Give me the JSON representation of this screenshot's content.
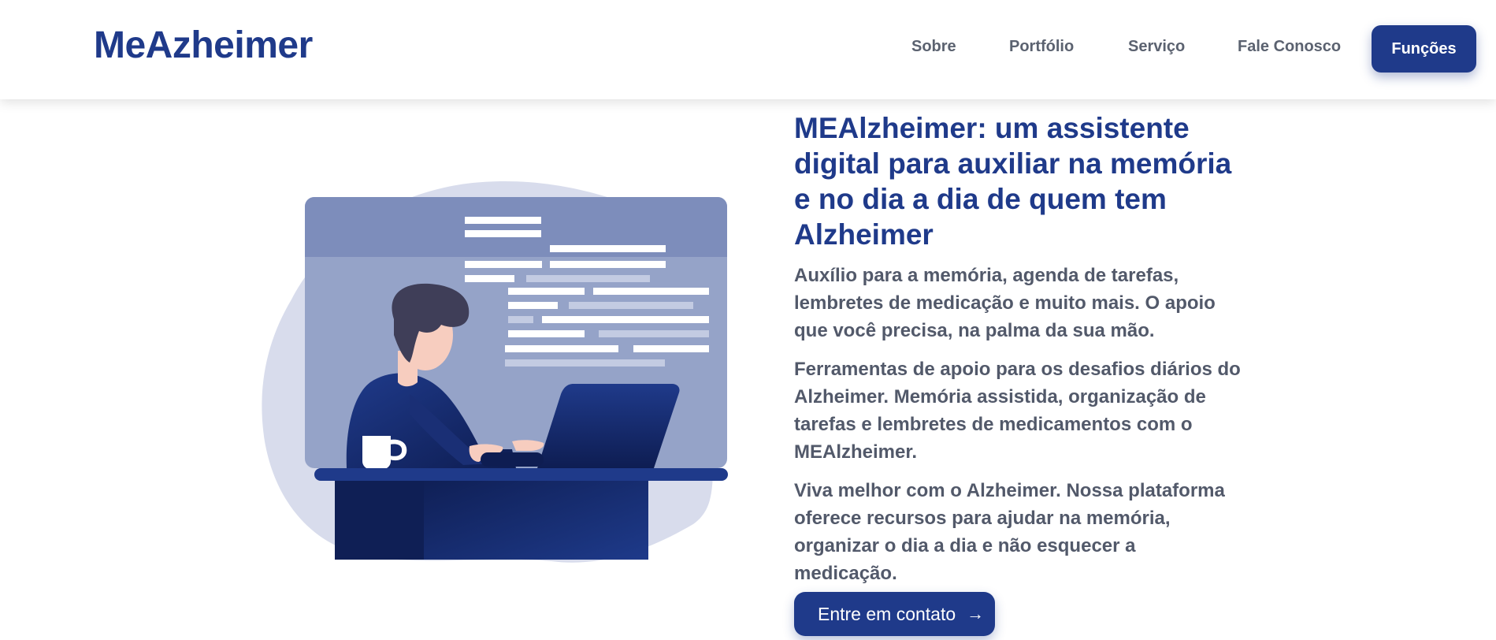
{
  "header": {
    "logo": "MeAzheimer",
    "nav": [
      {
        "label": "Sobre"
      },
      {
        "label": "Portfólio"
      },
      {
        "label": "Serviço"
      },
      {
        "label": "Fale Conosco"
      }
    ],
    "cta_label": "Funções"
  },
  "hero": {
    "headline": "MEAlzheimer: um assistente digital para auxiliar na memória e no dia a dia de quem tem Alzheimer",
    "paragraphs": [
      "Auxílio para a memória, agenda de tarefas, lembretes de medicação e muito mais. O apoio que você precisa, na palma da sua mão.",
      "Ferramentas de apoio para os desafios diários do Alzheimer. Memória assistida, organização de tarefas e lembretes de medicamentos com o MEAlzheimer.",
      "Viva melhor com o Alzheimer. Nossa plataforma oferece recursos para ajudar na memória, organizar o dia a dia e não esquecer a medicação."
    ],
    "cta_label": "Entre em contato",
    "cta_icon": "arrow-right-icon"
  },
  "colors": {
    "brand": "#1f3a8a",
    "text_muted": "#52596a",
    "screen_light": "#95a3c8",
    "screen_header": "#7d8dbb",
    "blob": "#d8dcec"
  }
}
